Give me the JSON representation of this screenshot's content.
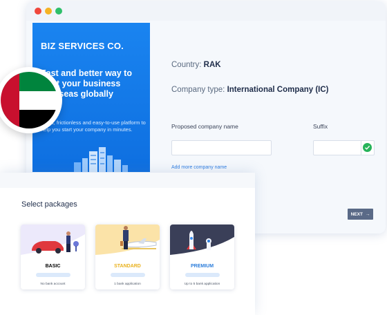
{
  "panel": {
    "brand": "BIZ SERVICES CO.",
    "tagline": "Fast and better way to start your business overseas globally",
    "description": "A fast, frictionless and easy-to-use platform to help you start your company in minutes."
  },
  "form": {
    "country_label": "Country:",
    "country_value": "RAK",
    "company_type_label": "Company type:",
    "company_type_value": "International Company (IC)",
    "proposed_name_label": "Proposed company name",
    "proposed_name_value": "",
    "suffix_label": "Suffix",
    "suffix_value": "",
    "add_more_link": "Add more company name",
    "next_label": "NEXT",
    "next_arrow": "→"
  },
  "packages": {
    "title": "Select packages",
    "items": [
      {
        "name": "BASIC",
        "note": "No bank account",
        "color": "#1f2d4a"
      },
      {
        "name": "STANDARD",
        "note": "1 bank application",
        "color": "#e9b11c"
      },
      {
        "name": "PREMIUM",
        "note": "Up to 5 bank application",
        "color": "#2b7ddb"
      }
    ]
  },
  "colors": {
    "accent": "#0e6fe0",
    "success": "#27b35a",
    "button": "#5a6a87"
  },
  "icons": [
    "uae-flag-icon",
    "check-circle-icon",
    "arrow-right-icon",
    "skyline-illustration"
  ]
}
